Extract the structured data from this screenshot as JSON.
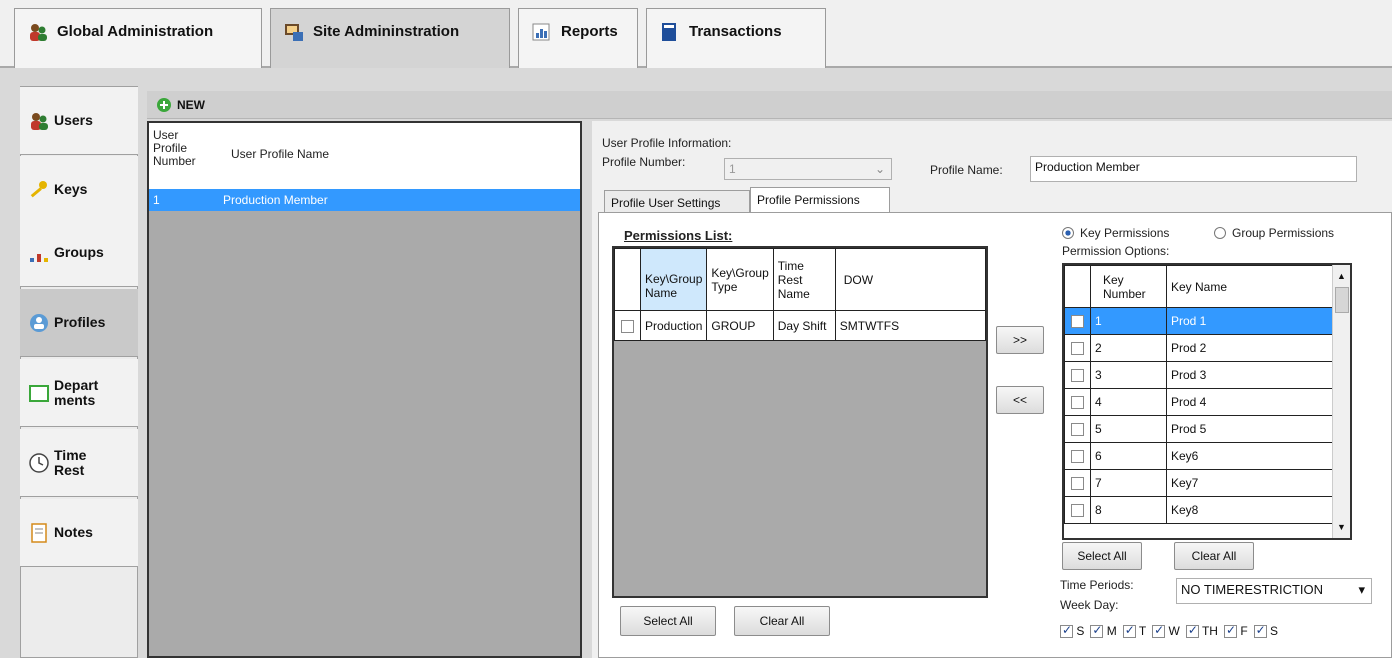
{
  "top_tabs": [
    {
      "label": "Global Administration",
      "icon": "users-icon"
    },
    {
      "label": "Site Admininstration",
      "icon": "site-admin-icon"
    },
    {
      "label": "Reports",
      "icon": "reports-icon"
    },
    {
      "label": "Transactions",
      "icon": "transactions-icon"
    }
  ],
  "sidebar": {
    "items": [
      {
        "label": "Users",
        "icon": "users-icon"
      },
      {
        "label": "Keys",
        "icon": "key-icon"
      },
      {
        "label": "Groups",
        "icon": "groups-icon"
      },
      {
        "label": "Profiles",
        "icon": "profile-icon"
      },
      {
        "label": "Depart ments",
        "icon": "department-icon"
      },
      {
        "label": "Time Rest",
        "icon": "clock-icon"
      },
      {
        "label": "Notes",
        "icon": "notes-icon"
      }
    ]
  },
  "toolbar": {
    "new_label": "NEW"
  },
  "profile_list": {
    "col1": "User Profile Number",
    "col2": "User Profile Name",
    "rows": [
      {
        "number": "1",
        "name": "Production Member"
      }
    ]
  },
  "profile_info": {
    "section_label": "User Profile Information:",
    "number_label": "Profile Number:",
    "number_value": "1",
    "name_label": "Profile Name:",
    "name_value": "Production Member"
  },
  "sub_tabs": [
    "Profile User Settings",
    "Profile Permissions"
  ],
  "permissions": {
    "title": "Permissions List:",
    "headers": [
      "Key\\Group Name",
      "Key\\Group Type",
      "Time Rest Name",
      "DOW"
    ],
    "rows": [
      [
        "Production",
        "GROUP",
        "Day Shift",
        "SMTWTFS"
      ]
    ],
    "select_all": "Select All",
    "clear_all": "Clear All"
  },
  "move": {
    "add": ">>",
    "remove": "<<"
  },
  "options": {
    "radio_key": "Key Permissions",
    "radio_group": "Group Permissions",
    "label": "Permission Options:",
    "headers": [
      "Key Number",
      "Key Name"
    ],
    "rows": [
      [
        "1",
        "Prod 1"
      ],
      [
        "2",
        "Prod 2"
      ],
      [
        "3",
        "Prod 3"
      ],
      [
        "4",
        "Prod 4"
      ],
      [
        "5",
        "Prod 5"
      ],
      [
        "6",
        "Key6"
      ],
      [
        "7",
        "Key7"
      ],
      [
        "8",
        "Key8"
      ]
    ],
    "select_all": "Select All",
    "clear_all": "Clear All",
    "time_periods_label": "Time Periods:",
    "time_periods_value": "NO TIMERESTRICTION",
    "week_day_label": "Week Day:",
    "days": [
      "S",
      "M",
      "T",
      "W",
      "TH",
      "F",
      "S"
    ]
  },
  "colors": {
    "selection": "#3399ff",
    "grid_bg": "#aaaaaa",
    "highlight_header": "#cfe8fc"
  }
}
